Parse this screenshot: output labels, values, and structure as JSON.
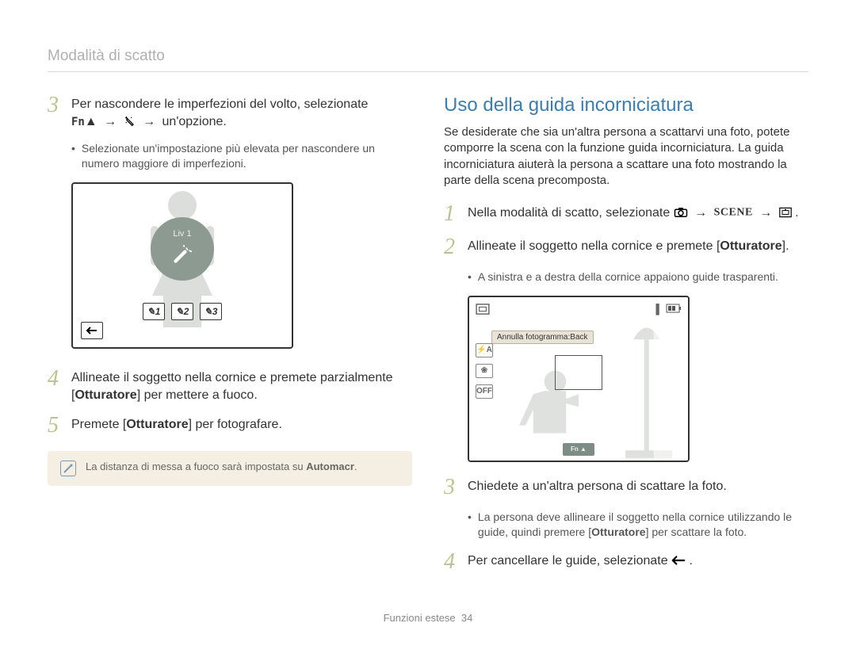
{
  "breadcrumb": "Modalità di scatto",
  "footer_label": "Funzioni estese",
  "footer_page": "34",
  "left": {
    "step3_num": "3",
    "step3_text_a": "Per nascondere le imperfezioni del volto, selezionate",
    "step3_fn": "Fn",
    "step3_arrow": "→",
    "step3_text_b": "un'opzione.",
    "step3_bullet": "Selezionate un'impostazione più elevata per nascondere un numero maggiore di imperfezioni.",
    "liv_label": "Liv 1",
    "icon1": "1",
    "icon2": "2",
    "icon3": "3",
    "step4_num": "4",
    "step4_text_a": "Allineate il soggetto nella cornice e premete parzialmente [",
    "step4_bold": "Otturatore",
    "step4_text_b": "] per mettere a fuoco.",
    "step5_num": "5",
    "step5_text_a": "Premete [",
    "step5_bold": "Otturatore",
    "step5_text_b": "] per fotografare.",
    "note_text_a": "La distanza di messa a fuoco sarà impostata su ",
    "note_bold": "Automacr",
    "note_text_b": "."
  },
  "right": {
    "title": "Uso della guida incorniciatura",
    "intro": "Se desiderate che sia un'altra persona a scattarvi una foto, potete comporre la scena con la funzione guida incorniciatura. La guida incorniciatura aiuterà la persona a scattare una foto mostrando la parte della scena precomposta.",
    "step1_num": "1",
    "step1_text_a": "Nella modalità di scatto, selezionate",
    "step1_arrow": "→",
    "step1_scene": "SCENE",
    "step1_period": ".",
    "step2_num": "2",
    "step2_text_a": "Allineate il soggetto nella cornice e premete [",
    "step2_bold": "Otturatore",
    "step2_text_b": "].",
    "step2_bullet": "A sinistra e a destra della cornice appaiono guide trasparenti.",
    "screenshot_label": "Annulla fotogramma:Back",
    "sb2_flash": "⚡A",
    "sb2_flower": "❀",
    "sb2_off": "OFF",
    "sb2_barL": "▌",
    "sb2_barR": "▌",
    "sb2_battery": "▮▮▮",
    "sb2_bottom": "Fn ▲",
    "step3_num": "3",
    "step3_text": "Chiedete a un'altra persona di scattare la foto.",
    "step3_bullet_a": "La persona deve allineare il soggetto nella cornice utilizzando le guide, quindi premere [",
    "step3_bullet_bold": "Otturatore",
    "step3_bullet_b": "] per scattare la foto.",
    "step4_num": "4",
    "step4_text_a": "Per cancellare le guide, selezionate",
    "step4_period": "."
  }
}
